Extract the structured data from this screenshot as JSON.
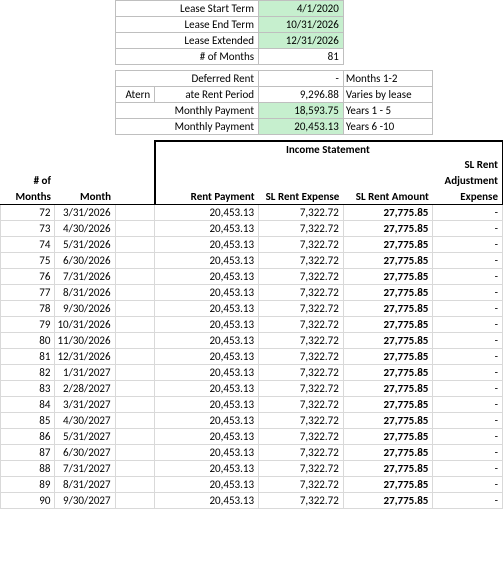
{
  "summary": {
    "lease_start_label": "Lease Start Term",
    "lease_start_value": "4/1/2020",
    "lease_end_label": "Lease End Term",
    "lease_end_value": "10/31/2026",
    "lease_ext_label": "Lease Extended",
    "lease_ext_value": "12/31/2026",
    "months_label": "# of Months",
    "months_value": "81",
    "deferred_rent_label": "Deferred Rent",
    "deferred_rent_value": "-",
    "deferred_rent_note": "Months 1-2",
    "aternate_label_left": "Atern",
    "aternate_label_right": "ate Rent Period",
    "aternate_value": "9,296.88",
    "aternate_note": "Varies by lease",
    "mp1_label": "Monthly Payment",
    "mp1_value": "18,593.75",
    "mp1_note": "Years 1 - 5",
    "mp2_label": "Monthly Payment",
    "mp2_value": "20,453.13",
    "mp2_note": "Years 6 -10"
  },
  "income_statement_header": "Income Statement",
  "columns": {
    "months_no": "# of Months",
    "month": "Month",
    "rent_payment": "Rent Payment",
    "sl_rent_expense": "SL Rent Expense",
    "sl_rent_amount": "SL Rent Amount",
    "sl_rent_adj_l1": "SL Rent",
    "sl_rent_adj_l2": "Adjustment",
    "sl_rent_adj_l3": "Expense"
  },
  "rows": [
    {
      "n": "72",
      "month": "3/31/2026",
      "pay": "20,453.13",
      "exp": "7,322.72",
      "amt": "27,775.85",
      "adj": "-"
    },
    {
      "n": "73",
      "month": "4/30/2026",
      "pay": "20,453.13",
      "exp": "7,322.72",
      "amt": "27,775.85",
      "adj": "-"
    },
    {
      "n": "74",
      "month": "5/31/2026",
      "pay": "20,453.13",
      "exp": "7,322.72",
      "amt": "27,775.85",
      "adj": "-"
    },
    {
      "n": "75",
      "month": "6/30/2026",
      "pay": "20,453.13",
      "exp": "7,322.72",
      "amt": "27,775.85",
      "adj": "-"
    },
    {
      "n": "76",
      "month": "7/31/2026",
      "pay": "20,453.13",
      "exp": "7,322.72",
      "amt": "27,775.85",
      "adj": "-"
    },
    {
      "n": "77",
      "month": "8/31/2026",
      "pay": "20,453.13",
      "exp": "7,322.72",
      "amt": "27,775.85",
      "adj": "-"
    },
    {
      "n": "78",
      "month": "9/30/2026",
      "pay": "20,453.13",
      "exp": "7,322.72",
      "amt": "27,775.85",
      "adj": "-"
    },
    {
      "n": "79",
      "month": "10/31/2026",
      "pay": "20,453.13",
      "exp": "7,322.72",
      "amt": "27,775.85",
      "adj": "-"
    },
    {
      "n": "80",
      "month": "11/30/2026",
      "pay": "20,453.13",
      "exp": "7,322.72",
      "amt": "27,775.85",
      "adj": "-"
    },
    {
      "n": "81",
      "month": "12/31/2026",
      "pay": "20,453.13",
      "exp": "7,322.72",
      "amt": "27,775.85",
      "adj": "-"
    },
    {
      "n": "82",
      "month": "1/31/2027",
      "pay": "20,453.13",
      "exp": "7,322.72",
      "amt": "27,775.85",
      "adj": "-"
    },
    {
      "n": "83",
      "month": "2/28/2027",
      "pay": "20,453.13",
      "exp": "7,322.72",
      "amt": "27,775.85",
      "adj": "-"
    },
    {
      "n": "84",
      "month": "3/31/2027",
      "pay": "20,453.13",
      "exp": "7,322.72",
      "amt": "27,775.85",
      "adj": "-"
    },
    {
      "n": "85",
      "month": "4/30/2027",
      "pay": "20,453.13",
      "exp": "7,322.72",
      "amt": "27,775.85",
      "adj": "-"
    },
    {
      "n": "86",
      "month": "5/31/2027",
      "pay": "20,453.13",
      "exp": "7,322.72",
      "amt": "27,775.85",
      "adj": "-"
    },
    {
      "n": "87",
      "month": "6/30/2027",
      "pay": "20,453.13",
      "exp": "7,322.72",
      "amt": "27,775.85",
      "adj": "-"
    },
    {
      "n": "88",
      "month": "7/31/2027",
      "pay": "20,453.13",
      "exp": "7,322.72",
      "amt": "27,775.85",
      "adj": "-"
    },
    {
      "n": "89",
      "month": "8/31/2027",
      "pay": "20,453.13",
      "exp": "7,322.72",
      "amt": "27,775.85",
      "adj": "-"
    },
    {
      "n": "90",
      "month": "9/30/2027",
      "pay": "20,453.13",
      "exp": "7,322.72",
      "amt": "27,775.85",
      "adj": "-"
    }
  ]
}
